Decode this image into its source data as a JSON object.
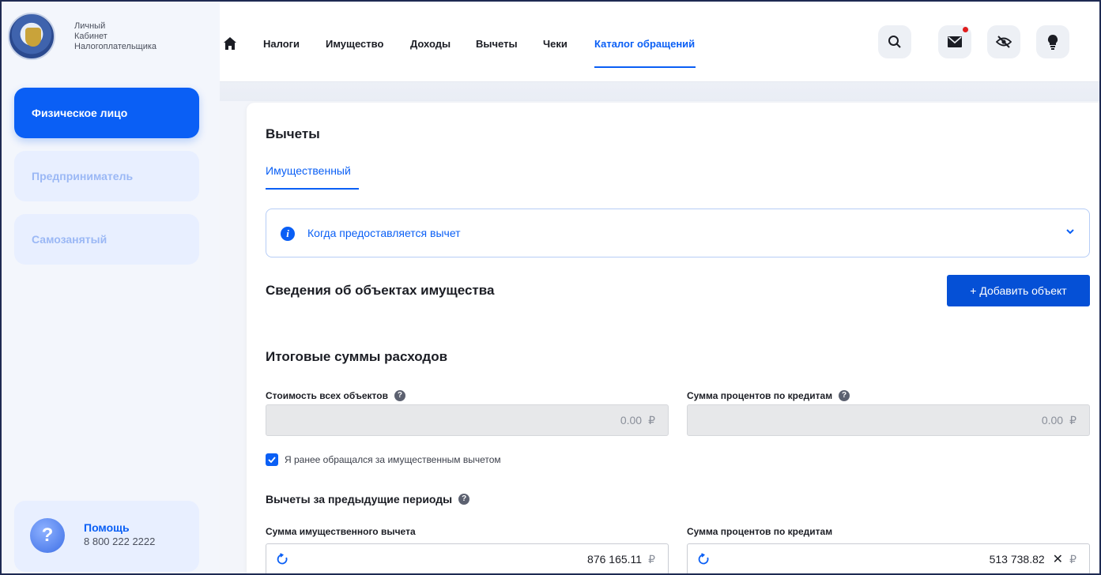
{
  "sidebar": {
    "logo_text": [
      "Личный",
      "Кабинет",
      "Налогоплательщика"
    ],
    "roles": [
      "Физическое лицо",
      "Предприниматель",
      "Самозанятый"
    ],
    "help_title": "Помощь",
    "help_phone": "8 800 222 2222"
  },
  "nav": {
    "items": [
      "Налоги",
      "Имущество",
      "Доходы",
      "Вычеты",
      "Чеки",
      "Каталог обращений"
    ],
    "active_index": 5
  },
  "main": {
    "title": "Вычеты",
    "tab": "Имущественный",
    "info_text": "Когда предоставляется вычет",
    "objects_title": "Сведения об объектах имущества",
    "add_button": "+ Добавить объект",
    "totals_title": "Итоговые суммы расходов",
    "cost_label": "Стоимость всех объектов",
    "cost_value": "0.00",
    "interest_label": "Сумма процентов по кредитам",
    "interest_value": "0.00",
    "checkbox_label": "Я ранее обращался за имущественным вычетом",
    "checkbox_checked": true,
    "prev_title": "Вычеты за предыдущие периоды",
    "prev_property_label": "Сумма имущественного вычета",
    "prev_property_value": "876 165.11",
    "prev_interest_label": "Сумма процентов по кредитам",
    "prev_interest_value": "513 738.82",
    "currency": "₽"
  },
  "colors": {
    "accent": "#0a5ff5",
    "button": "#0550d6",
    "notification": "#e01d1d"
  }
}
